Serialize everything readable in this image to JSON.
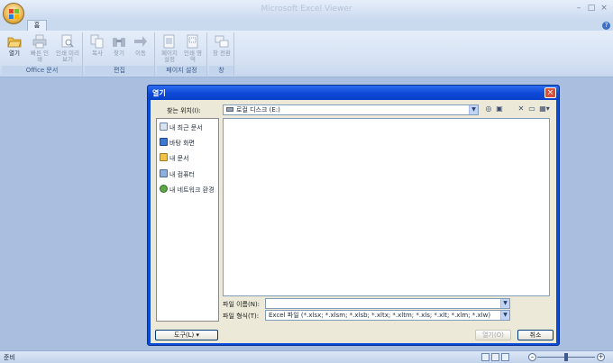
{
  "app": {
    "title": "Microsoft Excel Viewer",
    "window_buttons": {
      "minimize": "–",
      "restore": "□",
      "close": "×"
    }
  },
  "tabs": {
    "home": "홈",
    "help": "?"
  },
  "ribbon": {
    "groups": [
      {
        "label": "Office 문서",
        "buttons": [
          {
            "label": "열기",
            "icon": "open-folder-icon",
            "enabled": true
          },
          {
            "label": "빠른 인쇄",
            "icon": "printer-icon",
            "enabled": false
          },
          {
            "label": "인쇄 미리 보기",
            "icon": "print-preview-icon",
            "enabled": false
          }
        ]
      },
      {
        "label": "편집",
        "buttons": [
          {
            "label": "복사",
            "icon": "copy-icon",
            "enabled": false
          },
          {
            "label": "찾기",
            "icon": "binoculars-icon",
            "enabled": false
          },
          {
            "label": "이동",
            "icon": "arrow-right-icon",
            "enabled": false
          }
        ]
      },
      {
        "label": "페이지 설정",
        "buttons": [
          {
            "label": "페이지 설정",
            "icon": "page-setup-icon",
            "enabled": false
          },
          {
            "label": "인쇄 영역",
            "icon": "print-area-icon",
            "enabled": false
          }
        ]
      },
      {
        "label": "창",
        "buttons": [
          {
            "label": "창 전환",
            "icon": "switch-windows-icon",
            "enabled": false
          }
        ]
      }
    ]
  },
  "dialog": {
    "title": "열기",
    "look_in_label": "찾는 위치(I):",
    "look_in_value": "로컬 디스크 (E:)",
    "places": [
      {
        "label": "내 최근 문서",
        "icon": "recent-docs-icon"
      },
      {
        "label": "바탕 화면",
        "icon": "desktop-icon"
      },
      {
        "label": "내 문서",
        "icon": "my-documents-icon"
      },
      {
        "label": "내 컴퓨터",
        "icon": "my-computer-icon"
      },
      {
        "label": "내 네트워크 환경",
        "icon": "network-places-icon"
      }
    ],
    "file_name_label": "파일 이름(N):",
    "file_name_value": "",
    "file_type_label": "파일 형식(T):",
    "file_type_value": "Excel 파일 (*.xlsx; *.xlsm; *.xlsb; *.xltx; *.xltm; *.xls; *.xlt; *.xlm; *.xlw)",
    "tools_label": "도구(L)",
    "open_label": "열기(O)",
    "cancel_label": "취소"
  },
  "status": {
    "text": "준비"
  },
  "colors": {
    "dialog_frame": "#0a4ad8",
    "workspace": "#aabfdf",
    "ribbon": "#d4e1f3"
  }
}
